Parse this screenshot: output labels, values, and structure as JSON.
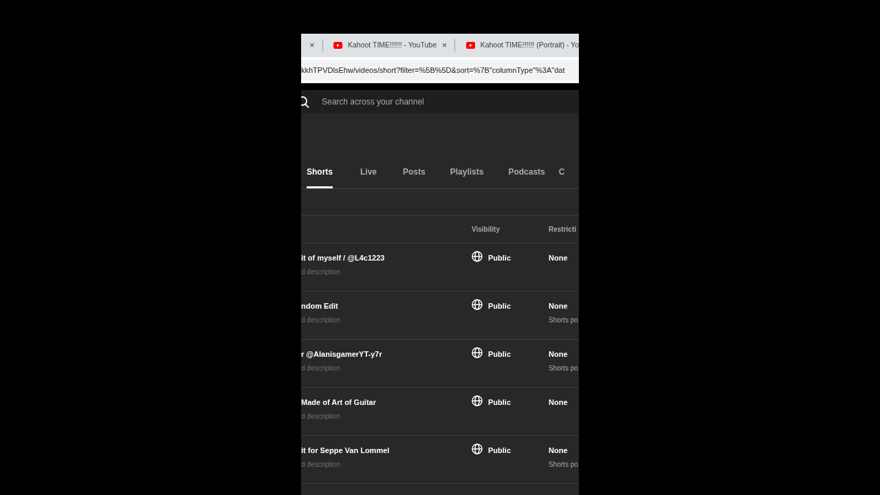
{
  "browser": {
    "tabs": [
      {
        "close": "×"
      },
      {
        "title": "Kahoot TIME!!!!!! - YouTube",
        "close": "×"
      },
      {
        "title": "Kahoot TIME!!!!!! (Portrait) - Yo"
      }
    ],
    "url": "kkhTPVDlsEhw/videos/short?filter=%5B%5D&sort=%7B\"columnType\"%3A\"dat"
  },
  "search": {
    "placeholder": "Search across your channel"
  },
  "content_tabs": [
    {
      "label": "Shorts",
      "selected": true
    },
    {
      "label": "Live",
      "selected": false
    },
    {
      "label": "Posts",
      "selected": false
    },
    {
      "label": "Playlists",
      "selected": false
    },
    {
      "label": "Podcasts",
      "selected": false
    },
    {
      "label": "C",
      "selected": false
    }
  ],
  "table": {
    "columns": [
      "Visibility",
      "Restricti"
    ],
    "rows": [
      {
        "title": "it of myself / @L4c1223",
        "description": "d description",
        "visibility": "Public",
        "restriction": "None"
      },
      {
        "title": "ndom Edit",
        "description": "d description",
        "visibility": "Public",
        "restriction": "None",
        "restriction_note": "Shorts po"
      },
      {
        "title": "r @AlanisgamerYT-y7r",
        "description": "d description",
        "visibility": "Public",
        "restriction": "None",
        "restriction_note": "Shorts po"
      },
      {
        "title": "Made of Art of Guitar",
        "description": "d description",
        "visibility": "Public",
        "restriction": "None"
      },
      {
        "title": "it for Seppe Van Lommel",
        "description": "d description",
        "visibility": "Public",
        "restriction": "None",
        "restriction_note": "Shorts po"
      }
    ]
  }
}
